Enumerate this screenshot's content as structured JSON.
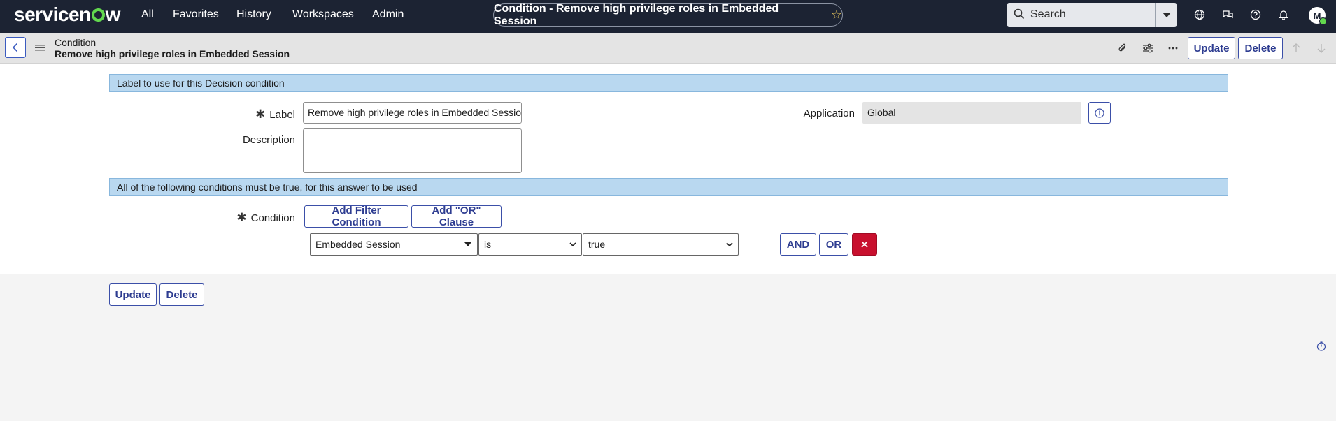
{
  "topnav": {
    "logo_pre": "servicen",
    "logo_post": "w",
    "items": [
      "All",
      "Favorites",
      "History",
      "Workspaces",
      "Admin"
    ],
    "record_title": "Condition - Remove high privilege roles in Embedded Session",
    "search_placeholder": "Search",
    "avatar_initial": "M"
  },
  "header": {
    "record_type": "Condition",
    "record_name": "Remove high privilege roles in Embedded Session",
    "update_label": "Update",
    "delete_label": "Delete"
  },
  "section1": {
    "title": "Label to use for this Decision condition",
    "label_field": {
      "label": "Label",
      "value": "Remove high privilege roles in Embedded Session"
    },
    "description_field": {
      "label": "Description",
      "value": ""
    },
    "application_field": {
      "label": "Application",
      "value": "Global"
    }
  },
  "section2": {
    "title": "All of the following conditions must be true, for this answer to be used",
    "condition_label": "Condition",
    "add_filter_label": "Add Filter Condition",
    "add_or_label": "Add \"OR\" Clause",
    "row": {
      "field": "Embedded Session",
      "operator": "is",
      "value": "true",
      "and_label": "AND",
      "or_label": "OR"
    }
  },
  "footer": {
    "update_label": "Update",
    "delete_label": "Delete"
  },
  "colors": {
    "nav_bg": "#1c2333",
    "accent": "#2e3d91",
    "section_bg": "#b9d8f0",
    "danger": "#c8102e",
    "logo_green": "#62d84e"
  }
}
